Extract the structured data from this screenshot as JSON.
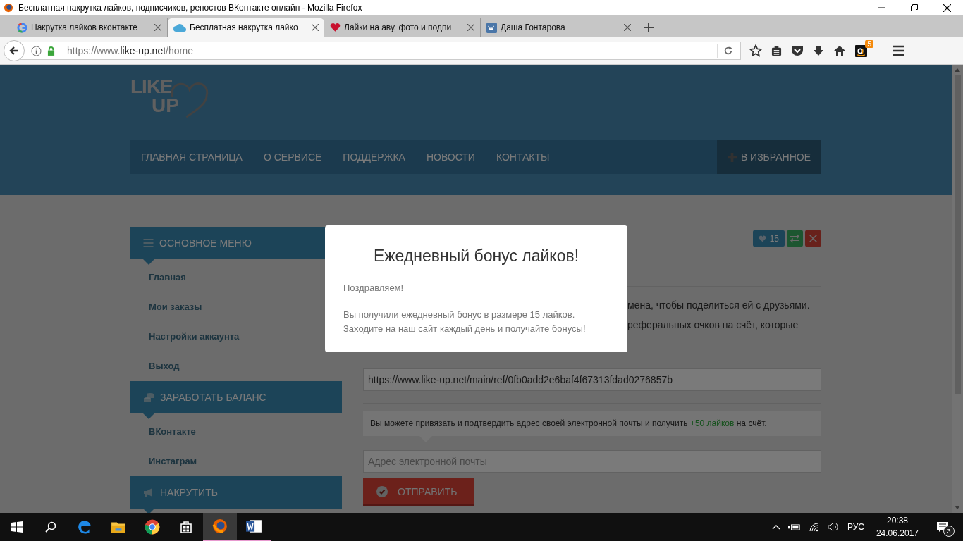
{
  "window": {
    "title": "Бесплатная накрутка лайков, подписчиков, репостов ВКонтакте онлайн - Mozilla Firefox"
  },
  "tabs": [
    {
      "title": "Накрутка лайков вконтакте",
      "kind": "google",
      "selected": false
    },
    {
      "title": "Бесплатная накрутка лайко",
      "kind": "cloud",
      "selected": true
    },
    {
      "title": "Лайки на аву, фото и подпи",
      "kind": "heart",
      "selected": false
    },
    {
      "title": "Даша Гонтарова",
      "kind": "vk",
      "selected": false
    }
  ],
  "address_bar": {
    "prefix": "https://www.",
    "domain": "like-up.net",
    "path": "/home"
  },
  "toolbar": {
    "amazon_badge": "5"
  },
  "site": {
    "logo": {
      "line1": "LIKE",
      "line2": "UP"
    },
    "nav": [
      "ГЛАВНАЯ СТРАНИЦА",
      "О СЕРВИСЕ",
      "ПОДДЕРЖКА",
      "НОВОСТИ",
      "КОНТАКТЫ"
    ],
    "favorite_button": "В ИЗБРАННОЕ",
    "sidebar": [
      {
        "title": "ОСНОВНОЕ МЕНЮ",
        "kind": "menu",
        "items": [
          "Главная",
          "Мои заказы",
          "Настройки аккаунта",
          "Выход"
        ]
      },
      {
        "title": "ЗАРАБОТАТЬ БАЛАНС",
        "kind": "coins",
        "items": [
          "ВКонтакте",
          "Инстаграм"
        ]
      },
      {
        "title": "НАКРУТИТЬ",
        "kind": "megaphone"
      }
    ],
    "likes_count": "15",
    "text_lines": [
      "мена, чтобы поделиться ей с друзьями.",
      "реферальных очков на счёт, которые"
    ],
    "referral_link": "https://www.like-up.net/main/ref/0fb0add2e6baf4f67313fdad0276857b",
    "email_note": {
      "before": "Вы можете привязать и подтвердить адрес своей электронной почты и получить",
      "highlight": "+50 лайков",
      "after": "на счёт."
    },
    "email_placeholder": "Адрес электронной почты",
    "submit_button": "ОТПРАВИТЬ"
  },
  "modal": {
    "title": "Ежедневный бонус лайков!",
    "paragraphs": [
      "Поздравляем!",
      "Вы получили ежедневный бонус в размере 15 лайков.\nЗаходите на наш сайт каждый день и получайте бонусы!"
    ]
  },
  "taskbar": {
    "apps": [
      {
        "kind": "edge",
        "selected": false,
        "open": false
      },
      {
        "kind": "explorer",
        "selected": false,
        "open": false
      },
      {
        "kind": "chrome",
        "selected": false,
        "open": false
      },
      {
        "kind": "store",
        "selected": false,
        "open": false
      },
      {
        "kind": "firefox",
        "selected": true,
        "open": true
      },
      {
        "kind": "word",
        "selected": false,
        "open": true
      }
    ],
    "language": "РУС",
    "time": "20:38",
    "date": "24.06.2017",
    "notifications": "3"
  }
}
